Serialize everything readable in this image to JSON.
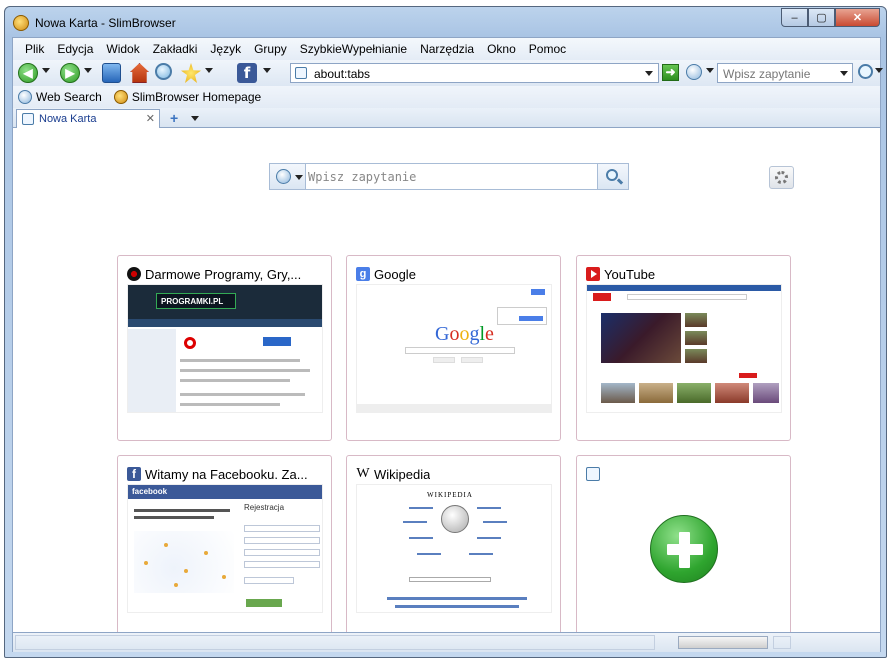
{
  "window": {
    "title": "Nowa Karta - SlimBrowser",
    "minimize": "–",
    "maximize": "▢",
    "close": "✕"
  },
  "menu": [
    "Plik",
    "Edycja",
    "Widok",
    "Zakładki",
    "Język",
    "Grupy",
    "SzybkieWypełnianie",
    "Narzędzia",
    "Okno",
    "Pomoc"
  ],
  "toolbar": {
    "back_glyph": "◀",
    "forward_glyph": "▶",
    "address": "about:tabs",
    "go_glyph": "➜",
    "search_placeholder": "Wpisz zapytanie",
    "fb_glyph": "f"
  },
  "links": [
    "Web Search",
    "SlimBrowser Homepage"
  ],
  "tabs": [
    {
      "label": "Nowa Karta",
      "close": "✕"
    }
  ],
  "tab_add": "+",
  "newtab": {
    "search_placeholder": "Wpisz zapytanie",
    "tiles": [
      {
        "title": "Darmowe Programy, Gry,...",
        "icon": "programki-icon"
      },
      {
        "title": "Google",
        "icon": "google-icon",
        "fav_glyph": "g"
      },
      {
        "title": "YouTube",
        "icon": "youtube-icon"
      },
      {
        "title": "Witamy na Facebooku. Za...",
        "icon": "facebook-icon",
        "fav_glyph": "f"
      },
      {
        "title": "Wikipedia",
        "icon": "wikipedia-icon",
        "fav_glyph": "W"
      },
      {
        "title": "",
        "icon": "add-site-icon"
      }
    ],
    "thumb_text": {
      "programki_logo": "PROGRAMKI.PL",
      "google_logo": [
        "G",
        "o",
        "o",
        "g",
        "l",
        "e"
      ],
      "facebook_logo": "facebook",
      "facebook_heading": "Rejestracja",
      "wikipedia_title": "WIKIPEDIA"
    }
  },
  "colors": {
    "accent": "#3b73c0",
    "add_green": "#2fa52f",
    "tile_border": "#d8b9c6"
  }
}
